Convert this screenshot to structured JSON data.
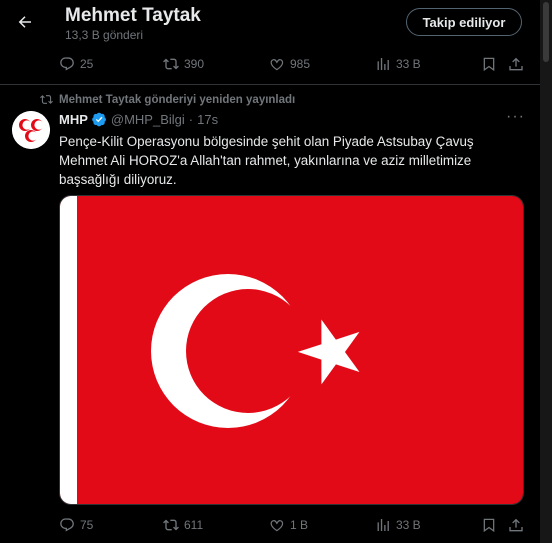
{
  "header": {
    "title": "Mehmet Taytak",
    "post_count": "13,3 B gönderi",
    "follow_label": "Takip ediliyor"
  },
  "prev_actions": {
    "replies": "25",
    "reposts": "390",
    "likes": "985",
    "views": "33 B"
  },
  "retweet": {
    "label": "Mehmet Taytak gönderiyi yeniden yayınladı"
  },
  "tweet": {
    "author_name": "MHP",
    "handle": "@MHP_Bilgi",
    "dot": "·",
    "time": "17s",
    "more": "···",
    "text": "Pençe-Kilit Operasyonu bölgesinde şehit olan Piyade Astsubay Çavuş Mehmet Ali HOROZ'a Allah'tan rahmet, yakınlarına ve aziz milletimize başsağlığı diliyoruz.",
    "media": {
      "flag_color": "#e30a17",
      "hoist_color": "#ffffff"
    },
    "actions": {
      "replies": "75",
      "reposts": "611",
      "likes": "1 B",
      "views": "33 B"
    }
  },
  "colors": {
    "background": "#000000",
    "text": "#e7e9ea",
    "muted": "#71767b",
    "verified": "#1d9bf0"
  },
  "icons": [
    "back-arrow-icon",
    "reply-icon",
    "repost-icon",
    "like-icon",
    "views-icon",
    "bookmark-icon",
    "share-icon",
    "verified-icon",
    "more-icon"
  ]
}
